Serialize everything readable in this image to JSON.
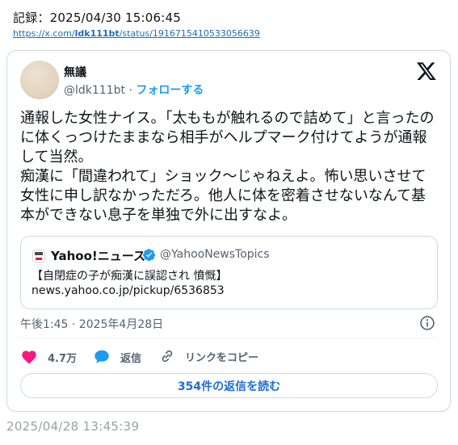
{
  "record": {
    "label": "記録：2025/04/30 15:06:45",
    "url_prefix": "https://x.com/",
    "url_bold": "ldk111bt",
    "url_suffix": "/status/1916715410533056639"
  },
  "tweet": {
    "author_name": "無議",
    "author_handle": "@ldk111bt",
    "separator": "·",
    "follow_label": "フォローする",
    "text": "通報した女性ナイス。「太ももが触れるので詰めて」と言ったのに体くっつけたままなら相手がヘルプマーク付けてようが通報して当然。\n痴漢に「間違われて」ショック〜じゃねえよ。怖い思いさせて女性に申し訳なかっただろ。他人に体を密着させないなんて基本ができない息子を単独で外に出すなよ。",
    "timestamp": "午後1:45 · 2025年4月28日",
    "icons": {
      "logo": "x-logo-icon",
      "info": "info-icon"
    }
  },
  "quote": {
    "source_name": "Yahoo!ニュース",
    "source_handle": "@YahooNewsTopics",
    "title": "【自閉症の子が痴漢に誤認され 憤慨】",
    "link": "news.yahoo.co.jp/pickup/6536853",
    "icons": {
      "logo": "yahoo-news-logo-icon",
      "verified": "verified-badge-icon"
    }
  },
  "actions": {
    "like_count": "4.7万",
    "reply_label": "返信",
    "copy_link_label": "リンクをコピー",
    "read_replies_label": "354件の返信を読む",
    "icons": {
      "like": "heart-icon",
      "reply": "speech-bubble-icon",
      "copy": "link-icon"
    }
  },
  "footer": {
    "date": "2025/04/28 13:45:39"
  },
  "colors": {
    "accent": "#1d9bf0",
    "like": "#f91880",
    "link": "#1d6fb8",
    "muted": "#536471",
    "border": "#cfd9de"
  }
}
